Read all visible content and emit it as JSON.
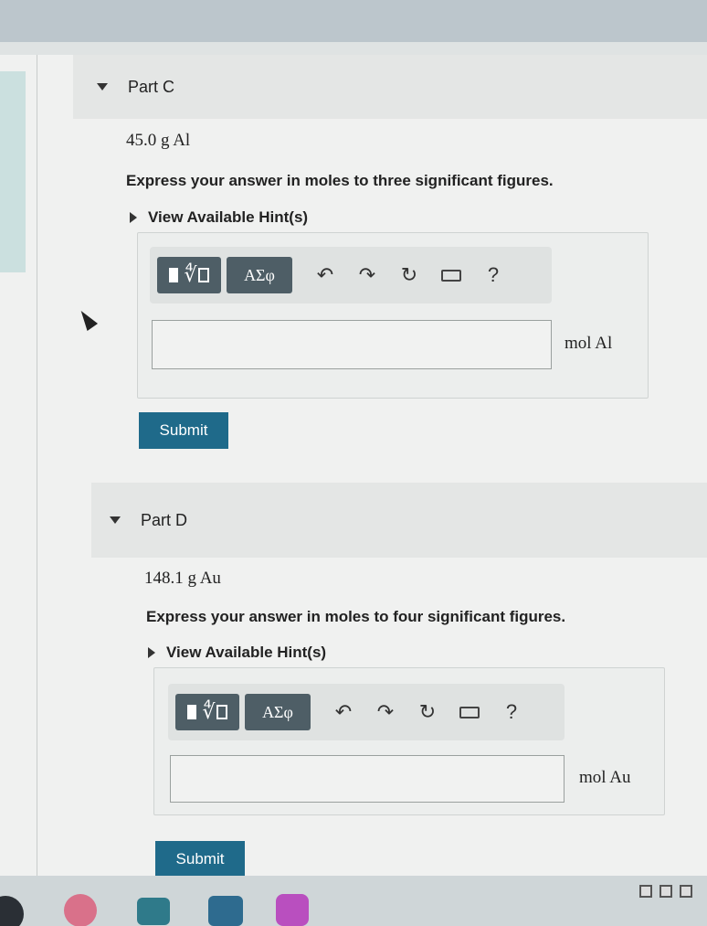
{
  "parts": [
    {
      "label": "Part C",
      "value": "45.0 g Al",
      "instruction": "Express your answer in moles to three significant figures.",
      "hint": "View Available Hint(s)",
      "toolbar": {
        "greek": "ΑΣφ",
        "help": "?"
      },
      "input_value": "",
      "unit": "mol Al",
      "submit": "Submit"
    },
    {
      "label": "Part D",
      "value": "148.1 g Au",
      "instruction": "Express your answer in moles to four significant figures.",
      "hint": "View Available Hint(s)",
      "toolbar": {
        "greek": "ΑΣφ",
        "help": "?"
      },
      "input_value": "",
      "unit": "mol Au",
      "submit": "Submit"
    }
  ],
  "icons": {
    "templates": "math-templates-icon",
    "undo": "undo-icon",
    "redo": "redo-icon",
    "reset": "reset-icon",
    "keyboard": "keyboard-icon",
    "help": "help-icon"
  },
  "colors": {
    "submit_bg": "#1f6a8a",
    "toolbar_button": "#4e5e66"
  }
}
